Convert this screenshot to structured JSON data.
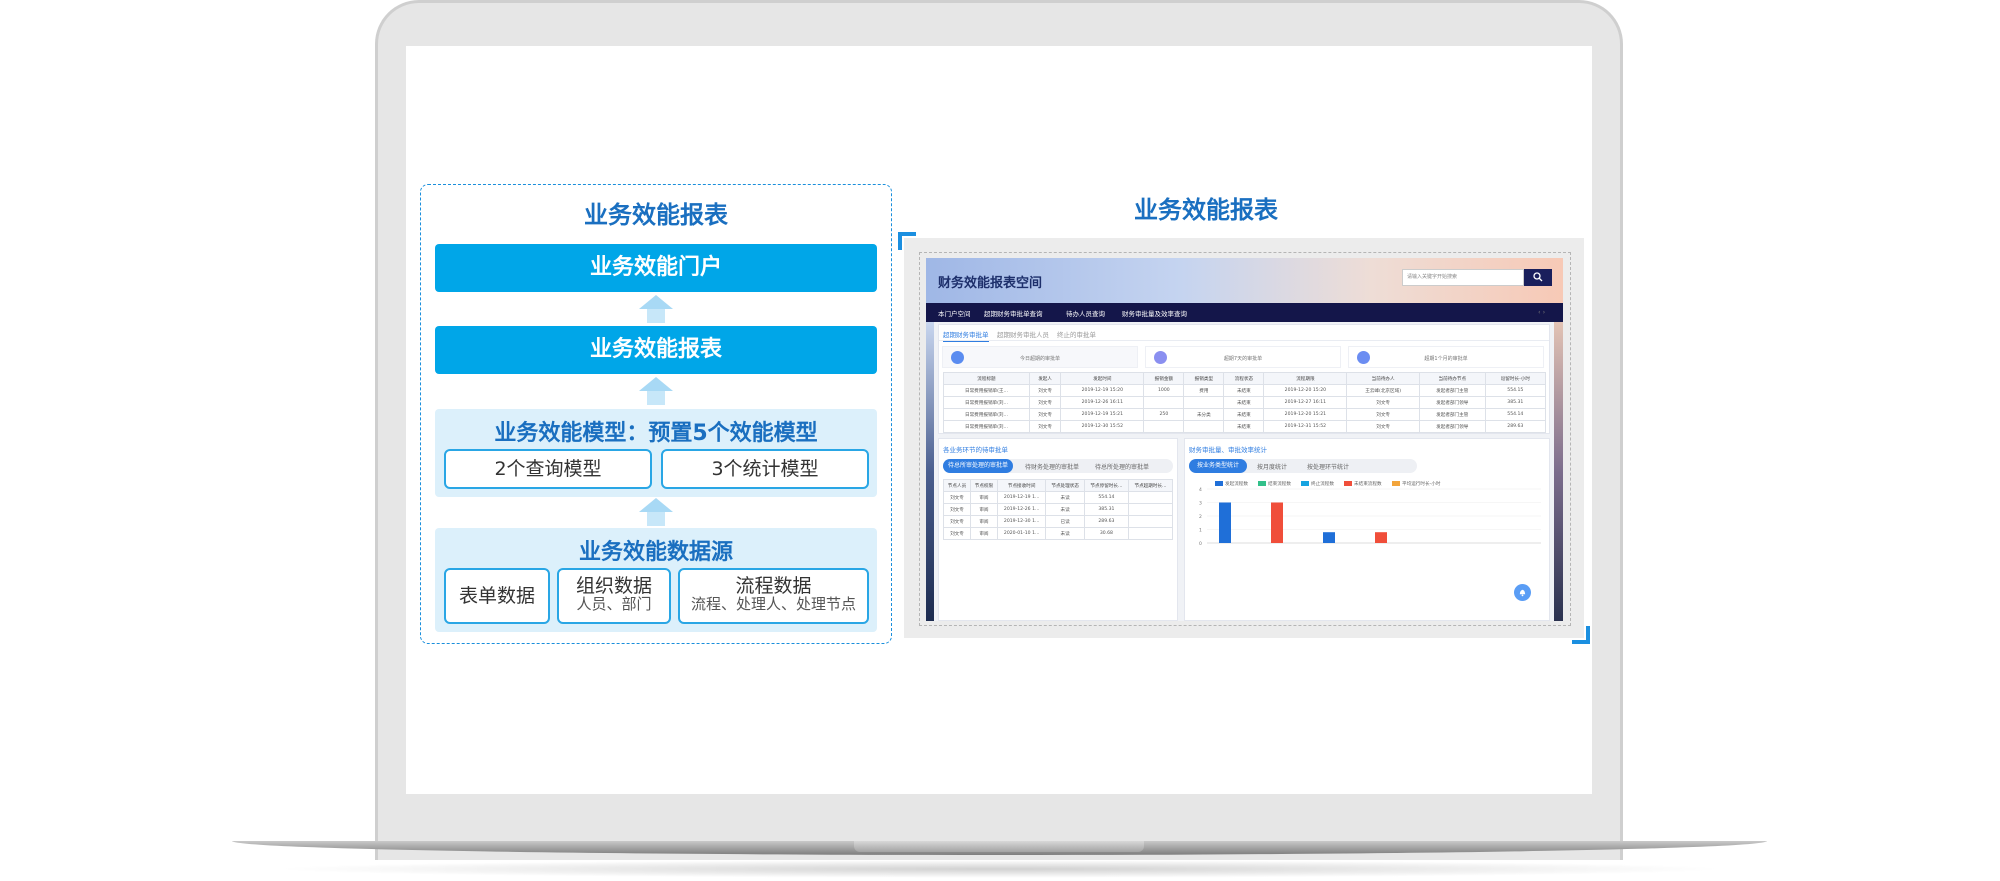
{
  "diagram": {
    "title": "业务效能报表",
    "portal": "业务效能门户",
    "report": "业务效能报表",
    "model_title": "业务效能模型：预置5个效能模型",
    "query_model": "2个查询模型",
    "stat_model": "3个统计模型",
    "source_title": "业务效能数据源",
    "form_data": "表单数据",
    "org_data": "组织数据",
    "org_sub": "人员、部门",
    "flow_data": "流程数据",
    "flow_sub": "流程、处理人、处理节点"
  },
  "right_title": "业务效能报表",
  "app": {
    "title": "财务效能报表空间",
    "search_placeholder": "请输入关键字开始搜索",
    "search_icon": "magnifier-icon",
    "nav": [
      "本门户空间",
      "超期财务审批单查询",
      "待办人员查询",
      "财务审批量及效率查询"
    ],
    "tabs": [
      "超期财务审批单",
      "超期财务审批人员",
      "终止的审批单"
    ],
    "stats": [
      "今日超期的审批单",
      "超期7天的审批单",
      "超期1个月的审批单"
    ],
    "table": {
      "headers": [
        "流程标题",
        "发起人",
        "发起时间",
        "报销金额",
        "报销类型",
        "流程状态",
        "流程期限",
        "当前待办人",
        "当前待办节点",
        "逗留时长-小时"
      ],
      "rows": [
        [
          "日常费用报销单(王...",
          "刘文专",
          "2019-12-19 15:20",
          "1000",
          "费用",
          "未结束",
          "2019-12-20 15:20",
          "王云峰(北京区域)",
          "发起者部门主管",
          "554.15"
        ],
        [
          "日常费用报销单(刘...",
          "刘文专",
          "2019-12-26 16:11",
          "",
          "",
          "未结束",
          "2019-12-27 16:11",
          "刘文专",
          "发起者部门领导",
          "385.31"
        ],
        [
          "日常费用报销单(刘...",
          "刘文专",
          "2019-12-19 15:21",
          "250",
          "未分类",
          "未结束",
          "2019-12-20 15:21",
          "刘文专",
          "发起者部门主管",
          "554.14"
        ],
        [
          "日常费用报销单(刘...",
          "刘文专",
          "2019-12-30 15:52",
          "",
          "",
          "未结束",
          "2019-12-31 15:52",
          "刘文专",
          "发起者部门领导",
          "289.63"
        ]
      ]
    },
    "card_left": {
      "title": "各业务环节的待审批单",
      "segments": [
        "待总所审处理的审批单",
        "待财务处理的审批单",
        "待总所处理的审批单"
      ],
      "headers": [
        "节点人员",
        "节点权限",
        "节点接收时间",
        "节点处理状态",
        "节点停留时长...",
        "节点超期时长..."
      ],
      "rows": [
        [
          "刘文专",
          "审阅",
          "2019-12-19 1...",
          "未读",
          "554.14",
          ""
        ],
        [
          "刘文专",
          "审阅",
          "2019-12-26 1...",
          "未读",
          "385.31",
          ""
        ],
        [
          "刘文专",
          "审阅",
          "2019-12-30 1...",
          "已读",
          "289.63",
          ""
        ],
        [
          "刘文专",
          "审阅",
          "2020-01-10 1...",
          "未读",
          "30.68",
          ""
        ]
      ]
    },
    "card_right": {
      "title": "财务审批量、审批效率统计",
      "segments": [
        "按业务类型统计",
        "按月度统计",
        "按处理环节统计"
      ],
      "legend": [
        {
          "label": "发起流程数",
          "color": "#1f6fd8"
        },
        {
          "label": "结束流程数",
          "color": "#32c08a"
        },
        {
          "label": "终止流程数",
          "color": "#16a3e0"
        },
        {
          "label": "未结束流程数",
          "color": "#f04e3a"
        },
        {
          "label": "平均运行时长-小时",
          "color": "#f2a43a"
        }
      ],
      "y_ticks": [
        "4",
        "3",
        "2",
        "1",
        "0"
      ]
    },
    "bell_icon": "bell-icon"
  },
  "chart_data": {
    "type": "bar",
    "series": [
      {
        "name": "发起流程数",
        "values": [
          3
        ]
      },
      {
        "name": "未结束流程数",
        "values": [
          3
        ]
      },
      {
        "name": "终止流程数",
        "values": [
          0.8
        ]
      },
      {
        "name": "未结束流程数",
        "values": [
          0.8
        ]
      }
    ],
    "ylim": [
      0,
      4
    ]
  }
}
